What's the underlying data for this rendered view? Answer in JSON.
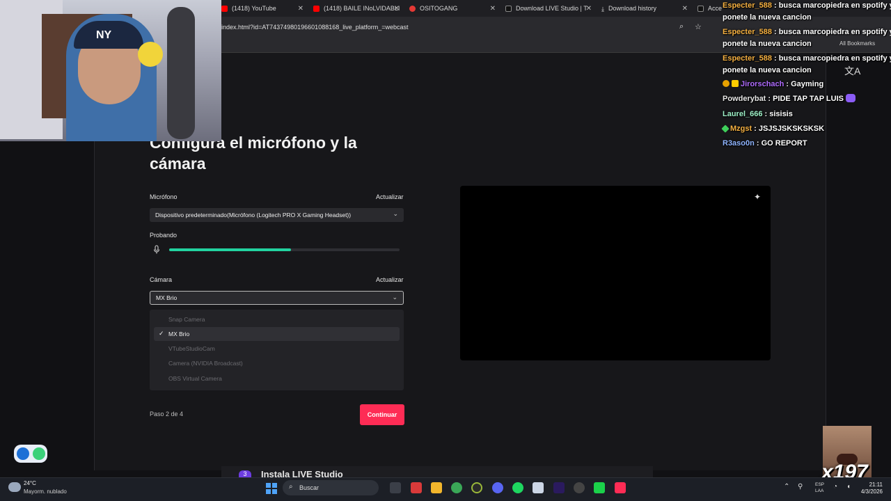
{
  "browser": {
    "tabs": [
      {
        "label": "(1418) YouTube",
        "color": "#ff0000"
      },
      {
        "label": "(1418) BAILE INoLVIDABLI",
        "color": "#ff0000"
      },
      {
        "label": "OSITOGANG",
        "color": "#e53935"
      },
      {
        "label": "Download LIVE Studio | T",
        "color": "#111111"
      },
      {
        "label": "Download history",
        "color": "#cccccc"
      },
      {
        "label": "Acce",
        "color": "#111111"
      }
    ],
    "url": "index.html?id=AT74374980196601088168_live_platform_=webcast",
    "all_bookmarks": "All Bookmarks"
  },
  "setup": {
    "title": "Configura el micrófono y la cámara",
    "mic_label": "Micrófono",
    "mic_refresh": "Actualizar",
    "mic_value": "Dispositivo predeterminado(Micrófono (Logitech PRO X Gaming Headset))",
    "testing_label": "Probando",
    "mic_level": 0.53,
    "camera_label": "Cámara",
    "camera_refresh": "Actualizar",
    "camera_value": "MX Brio",
    "camera_options": [
      {
        "label": "Snap Camera",
        "selected": false
      },
      {
        "label": "MX Brio",
        "selected": true
      },
      {
        "label": "VTubeStudioCam",
        "selected": false
      },
      {
        "label": "Camera (NVIDIA Broadcast)",
        "selected": false
      },
      {
        "label": "OBS Virtual Camera",
        "selected": false
      }
    ],
    "step": "Paso 2 de 4",
    "continue": "Continuar",
    "next_number": "3",
    "next_title": "Instala LIVE Studio",
    "accent": "#fe2c55",
    "level_color": "#22d3a0"
  },
  "chat": [
    {
      "user": "Especter_588",
      "msg": "busca marcopiedra en spotify y",
      "color": "#f5b041"
    },
    {
      "user": "",
      "msg": "ponete la nueva cancion",
      "color": "#ffffff"
    },
    {
      "user": "Especter_588",
      "msg": "busca marcopiedra en spotify y",
      "color": "#f5b041"
    },
    {
      "user": "",
      "msg": "ponete la nueva cancion",
      "color": "#ffffff"
    },
    {
      "user": "Especter_588",
      "msg": "busca marcopiedra en spotify y",
      "color": "#f5b041"
    },
    {
      "user": "",
      "msg": "ponete la nueva cancion",
      "color": "#ffffff"
    },
    {
      "user": "Jirorschach",
      "msg": "Gayming",
      "color": "#b06cff"
    },
    {
      "user": "Powderybat",
      "msg": "PIDE TAP TAP LUIS",
      "color": "#e6e6e6"
    },
    {
      "user": "Laurel_666",
      "msg": "sisisis",
      "color": "#9ef0c8"
    },
    {
      "user": "Mzgst",
      "msg": "JSJSJSKSKSKSK",
      "color": "#f5b041"
    },
    {
      "user": "R3aso0n",
      "msg": "GO REPORT",
      "color": "#8fb4ff"
    }
  ],
  "overlay": {
    "webcam_cap": "NY",
    "x197": "x197"
  },
  "taskbar": {
    "temp": "24°C",
    "weather": "Mayorm. nublado",
    "search": "Buscar",
    "lang1": "ESP",
    "lang2": "LAA",
    "time": "21:11",
    "date": "4/3/2026"
  }
}
